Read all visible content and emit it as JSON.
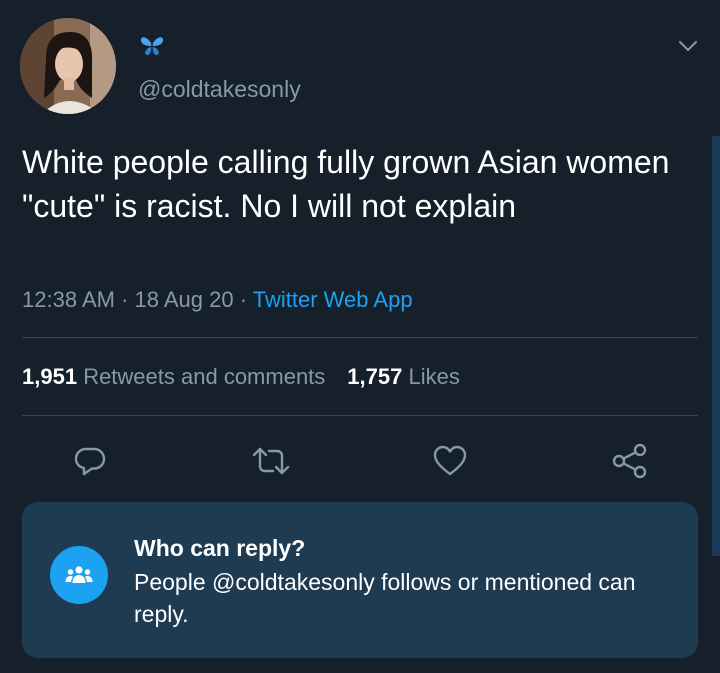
{
  "tweet": {
    "handle": "@coldtakesonly",
    "text": "White people calling fully grown Asian women \"cute\" is racist. No I will not explain",
    "time": "12:38 AM",
    "date": "18 Aug 20",
    "separator": " · ",
    "source": "Twitter Web App"
  },
  "stats": {
    "retweets_count": "1,951",
    "retweets_label": "Retweets and comments",
    "likes_count": "1,757",
    "likes_label": "Likes"
  },
  "actions": [
    {
      "icon": "reply-icon"
    },
    {
      "icon": "retweet-icon"
    },
    {
      "icon": "like-icon"
    },
    {
      "icon": "share-icon"
    }
  ],
  "who_can_reply": {
    "title": "Who can reply?",
    "body": "People @coldtakesonly follows or mentioned can reply.",
    "icon": "people-icon"
  },
  "colors": {
    "background": "#15202b",
    "secondary_text": "#8899a6",
    "accent": "#1da1f2",
    "card": "#1e3b52",
    "divider": "#38444d"
  }
}
